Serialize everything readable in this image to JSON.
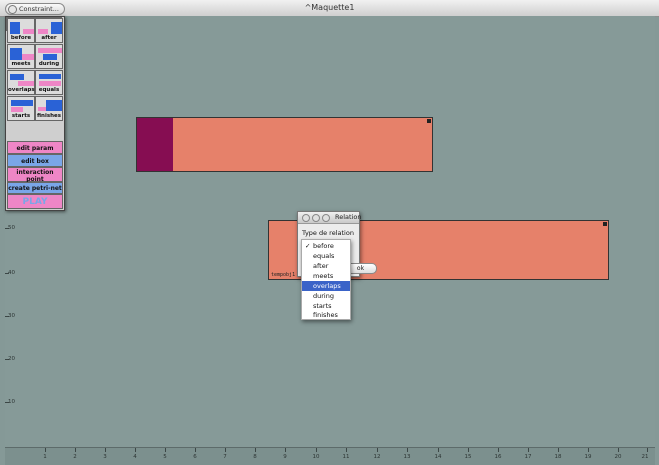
{
  "window": {
    "title": "^Maquette1",
    "tab_label": "Constraint..."
  },
  "palette": {
    "relations": [
      "before",
      "after",
      "meets",
      "during",
      "overlaps",
      "equals",
      "starts",
      "finishes"
    ],
    "buttons": [
      {
        "label": "edit param",
        "color": "#ee86c6"
      },
      {
        "label": "edit box",
        "color": "#7aa6e8"
      },
      {
        "label": "interaction point",
        "color": "#ee86c6"
      },
      {
        "label": "create petri-net",
        "color": "#7aa6e8"
      },
      {
        "label": "PLAY",
        "color": "#ee86c6"
      }
    ],
    "play_color": "#7aa6e8"
  },
  "boxes": {
    "box2_label": "tempobj1"
  },
  "dialog": {
    "title": "Relation",
    "type_label": "Type de relation",
    "ok_label": "ok",
    "options": [
      "before",
      "equals",
      "after",
      "meets",
      "overlaps",
      "during",
      "starts",
      "finishes"
    ],
    "checked": "before",
    "highlighted": "overlaps"
  },
  "axes": {
    "x_labels": [
      "1",
      "2",
      "3",
      "4",
      "5",
      "6",
      "7",
      "8",
      "9",
      "10",
      "11",
      "12",
      "13",
      "14",
      "15",
      "16",
      "17",
      "18",
      "19",
      "20",
      "21"
    ],
    "y_labels": [
      "50",
      "40",
      "30",
      "20",
      "10"
    ]
  },
  "colors": {
    "canvas": "#869a98",
    "box": "#e6816a",
    "box_head": "#860d52",
    "blue": "#2a62d6",
    "pink": "#ee86c6",
    "highlight": "#3a63c8"
  }
}
